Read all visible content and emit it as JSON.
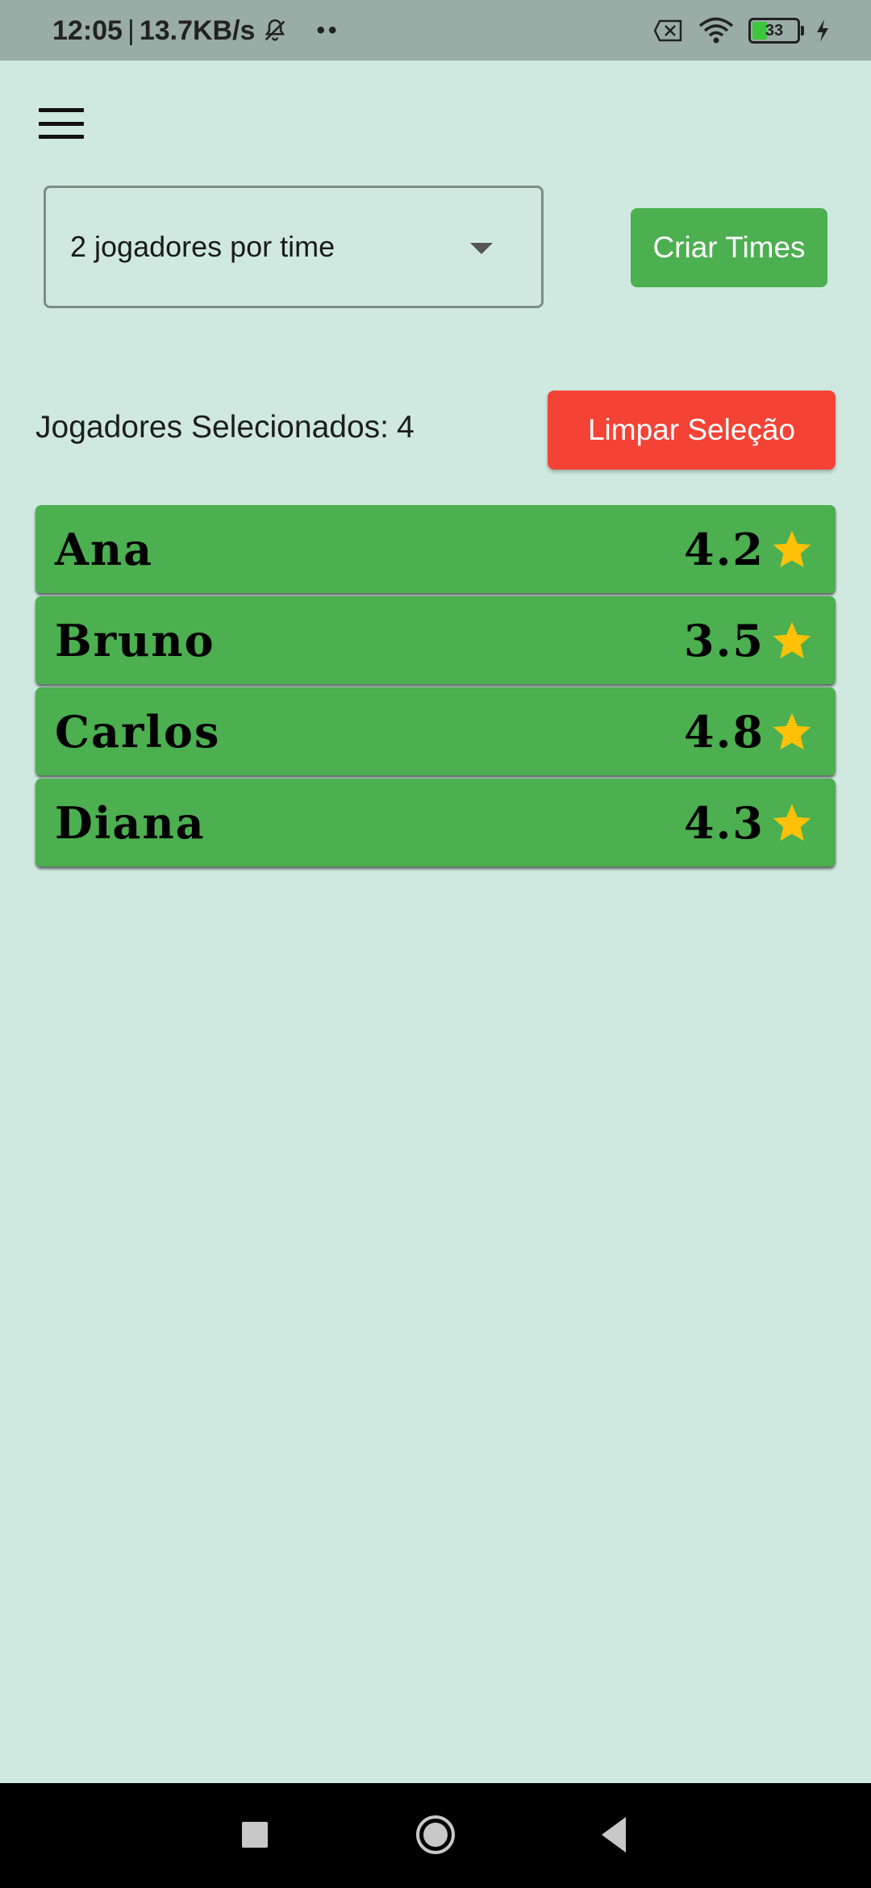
{
  "status_bar": {
    "time": "12:05",
    "separator": "|",
    "speed": "13.7KB/s",
    "dots": "••",
    "battery_level": "33",
    "battery_fraction": 0.33,
    "icons": [
      "bell-muted-icon",
      "sim-off-icon",
      "wifi-icon",
      "battery-icon",
      "charging-icon"
    ]
  },
  "header": {
    "menu_icon": "hamburger-menu-icon"
  },
  "controls": {
    "team_size_selected": "2 jogadores por time",
    "create_teams_label": "Criar Times",
    "selected_label": "Jogadores Selecionados:",
    "selected_count": "4",
    "clear_selection_label": "Limpar Seleção"
  },
  "players": [
    {
      "name": "Ana",
      "rating": "4.2"
    },
    {
      "name": "Bruno",
      "rating": "3.5"
    },
    {
      "name": "Carlos",
      "rating": "4.8"
    },
    {
      "name": "Diana",
      "rating": "4.3"
    }
  ],
  "colors": {
    "background": "#cfe9e0",
    "status_bar": "#99aca5",
    "player_card": "#4caf50",
    "create_button": "#4caf50",
    "clear_button": "#f44336",
    "star": "#ffc107"
  },
  "nav_bar": {
    "icons": [
      "recent-apps-icon",
      "home-icon",
      "back-icon"
    ]
  }
}
